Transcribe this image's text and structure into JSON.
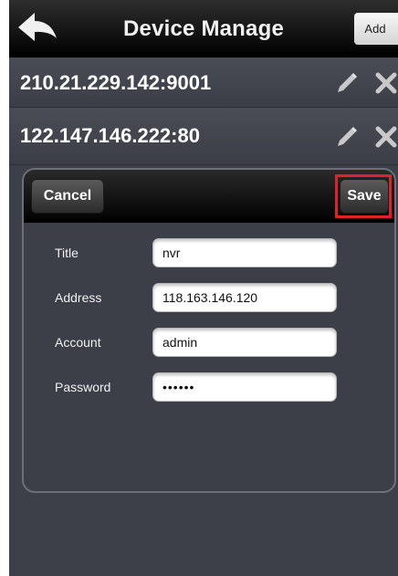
{
  "navbar": {
    "title": "Device Manage",
    "add_label": "Add"
  },
  "devices": [
    {
      "address": "210.21.229.142:9001"
    },
    {
      "address": "122.147.146.222:80"
    }
  ],
  "edit_panel": {
    "cancel_label": "Cancel",
    "save_label": "Save",
    "fields": {
      "title": {
        "label": "Title",
        "value": "nvr"
      },
      "address": {
        "label": "Address",
        "value": "118.163.146.120"
      },
      "account": {
        "label": "Account",
        "value": "admin"
      },
      "password": {
        "label": "Password",
        "value": "••••••"
      }
    }
  },
  "icons": {
    "back": "back-arrow-icon",
    "edit": "pencil-icon",
    "delete": "close-icon"
  },
  "colors": {
    "highlight": "#e0202a",
    "background": "#3d4048"
  }
}
